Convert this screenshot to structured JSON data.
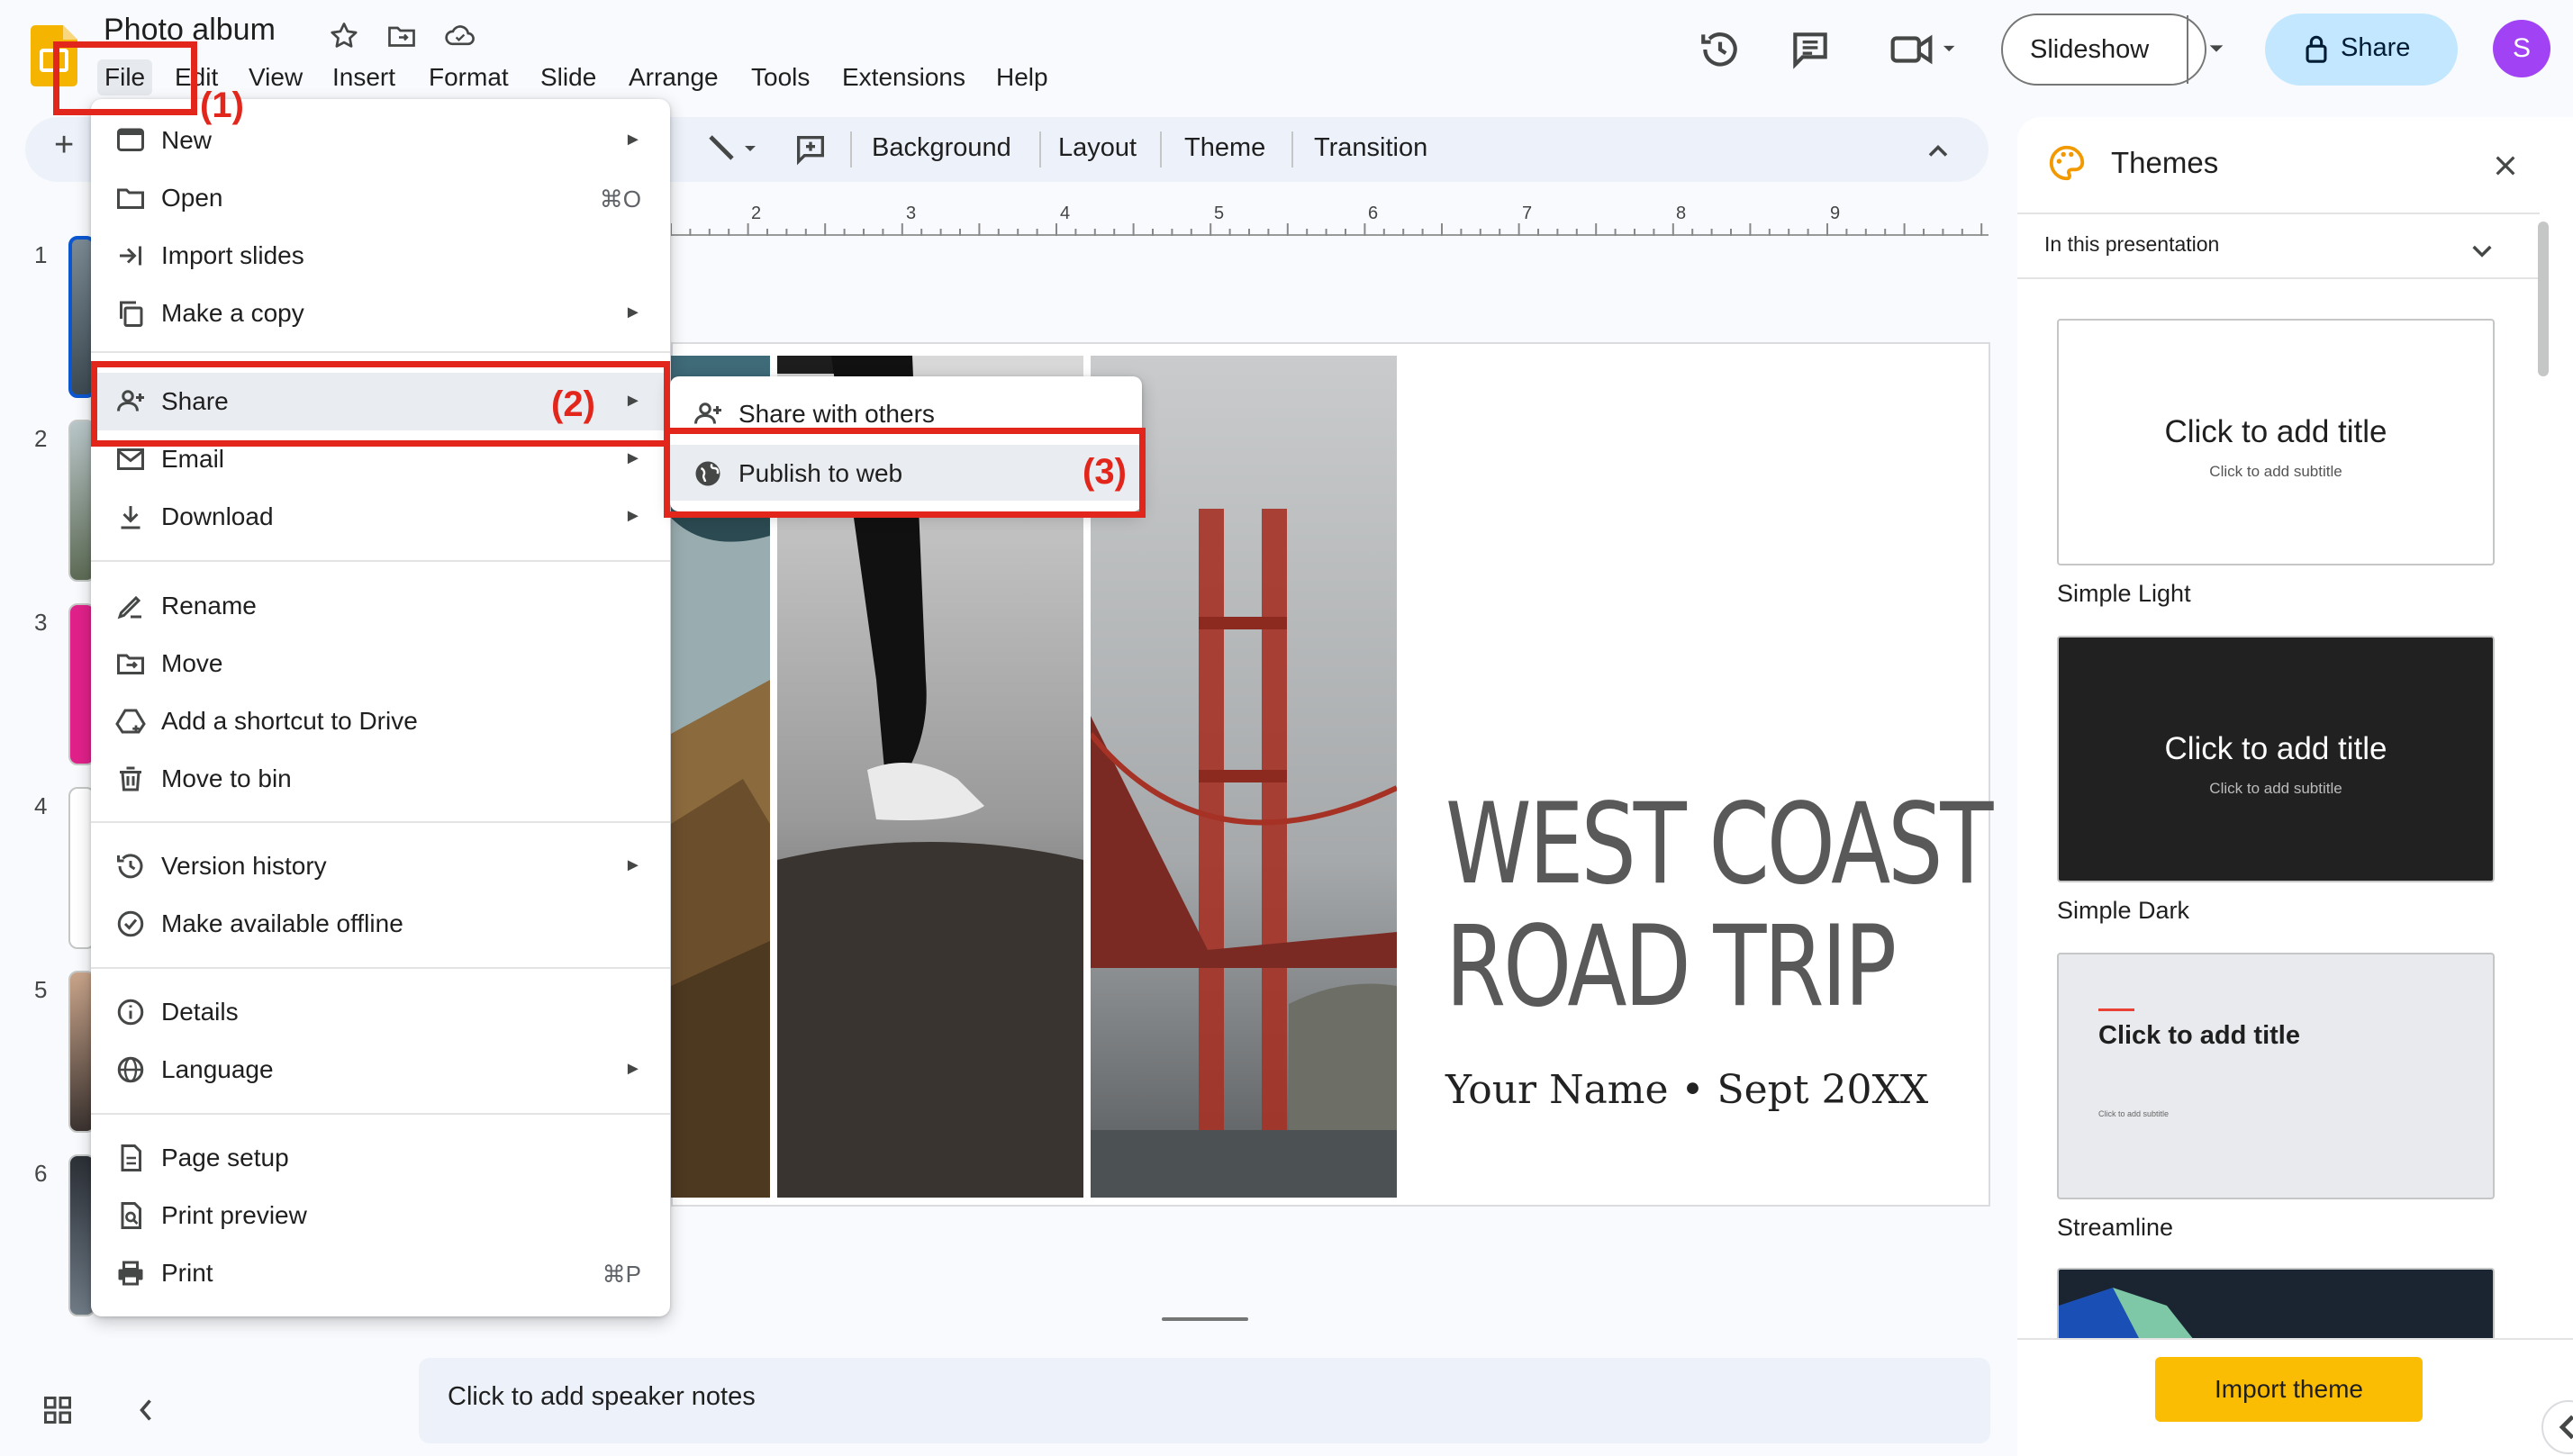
{
  "app": {
    "title": "Photo album",
    "menus": [
      "File",
      "Edit",
      "View",
      "Insert",
      "Format",
      "Slide",
      "Arrange",
      "Tools",
      "Extensions",
      "Help"
    ],
    "slideshow_label": "Slideshow",
    "share_label": "Share",
    "avatar_initial": "S"
  },
  "toolbar": {
    "add_label": "+",
    "background_label": "Background",
    "layout_label": "Layout",
    "theme_label": "Theme",
    "transition_label": "Transition"
  },
  "ruler": [
    "2",
    "3",
    "4",
    "5",
    "6",
    "7",
    "8",
    "9"
  ],
  "filmstrip": {
    "slide_numbers": [
      "1",
      "2",
      "3",
      "4",
      "5",
      "6"
    ]
  },
  "slide": {
    "headline_line1": "WEST COAST",
    "headline_line2": "ROAD TRIP",
    "subtitle": "Your Name • Sept 20XX"
  },
  "notes": {
    "placeholder": "Click to add speaker notes"
  },
  "file_menu": {
    "items": [
      {
        "label": "New",
        "has_submenu": true,
        "icon": "new-presentation-icon"
      },
      {
        "label": "Open",
        "shortcut": "⌘O",
        "icon": "folder-icon"
      },
      {
        "label": "Import slides",
        "icon": "import-icon"
      },
      {
        "label": "Make a copy",
        "has_submenu": true,
        "icon": "copy-icon"
      },
      {
        "label": "Share",
        "has_submenu": true,
        "icon": "share-person-icon"
      },
      {
        "label": "Email",
        "has_submenu": true,
        "icon": "email-icon"
      },
      {
        "label": "Download",
        "has_submenu": true,
        "icon": "download-icon"
      },
      {
        "label": "Rename",
        "icon": "rename-icon"
      },
      {
        "label": "Move",
        "icon": "move-icon"
      },
      {
        "label": "Add a shortcut to Drive",
        "icon": "drive-shortcut-icon"
      },
      {
        "label": "Move to bin",
        "icon": "trash-icon"
      },
      {
        "label": "Version history",
        "has_submenu": true,
        "icon": "history-icon"
      },
      {
        "label": "Make available offline",
        "icon": "offline-icon"
      },
      {
        "label": "Details",
        "icon": "info-icon"
      },
      {
        "label": "Language",
        "has_submenu": true,
        "icon": "globe-icon"
      },
      {
        "label": "Page setup",
        "icon": "page-icon"
      },
      {
        "label": "Print preview",
        "icon": "print-preview-icon"
      },
      {
        "label": "Print",
        "shortcut": "⌘P",
        "icon": "printer-icon"
      }
    ]
  },
  "share_submenu": {
    "items": [
      {
        "label": "Share with others",
        "icon": "share-person-icon"
      },
      {
        "label": "Publish to web",
        "icon": "globe-icon"
      }
    ]
  },
  "annotations": {
    "step1": "(1)",
    "step2": "(2)",
    "step3": "(3)",
    "color": "#e3261b"
  },
  "themes": {
    "title": "Themes",
    "filter": "In this presentation",
    "cards": [
      {
        "name": "Simple Light",
        "title": "Click to add title",
        "subtitle": "Click to add subtitle"
      },
      {
        "name": "Simple Dark",
        "title": "Click to add title",
        "subtitle": "Click to add subtitle"
      },
      {
        "name": "Streamline",
        "title": "Click to add title",
        "subtitle": "Click to add subtitle"
      }
    ],
    "import_label": "Import theme"
  },
  "colors": {
    "accent_blue": "#c2e7ff",
    "import_yellow": "#fbbc04",
    "avatar_purple": "#a142f4",
    "slides_yellow": "#f4b400"
  }
}
